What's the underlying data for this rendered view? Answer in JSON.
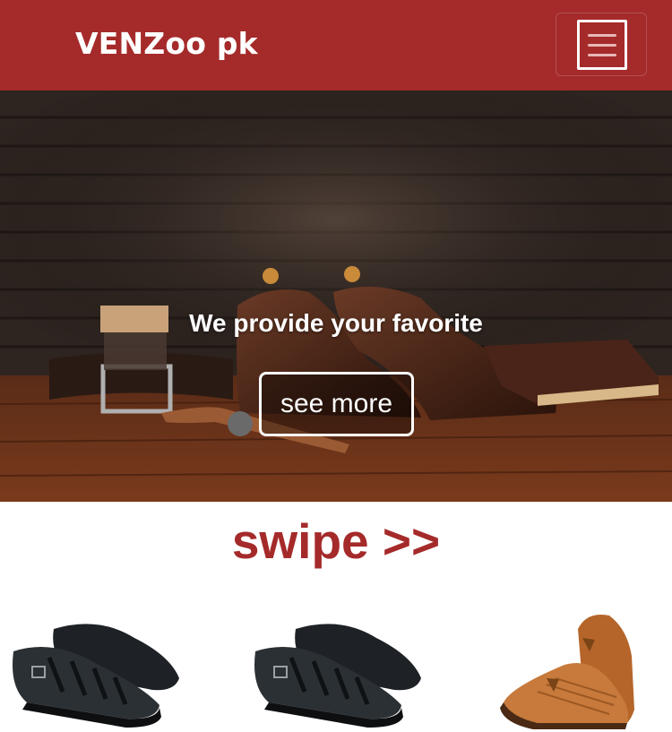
{
  "brand": {
    "name": "VENZoo pk",
    "color": "#a52a2a"
  },
  "nav": {
    "menu_icon": "hamburger-menu-icon"
  },
  "hero": {
    "headline": "We provide your favorite",
    "button_label": "see more"
  },
  "section": {
    "swipe_label": "swipe >>"
  },
  "products": [
    {
      "name": "black sandal",
      "icon": "black-sandal-image"
    },
    {
      "name": "black sandal",
      "icon": "black-sandal-image"
    },
    {
      "name": "brown peshawari chappal",
      "icon": "brown-sandal-image"
    }
  ]
}
